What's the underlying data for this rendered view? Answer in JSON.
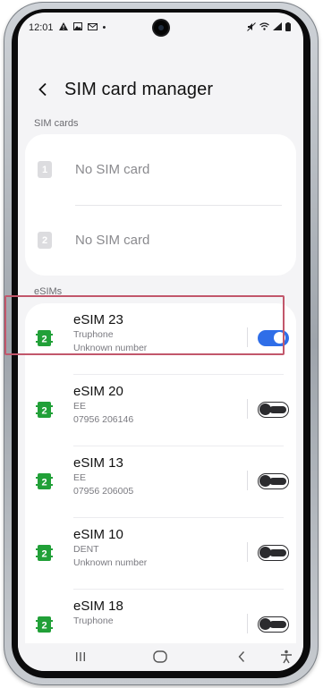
{
  "status_bar": {
    "time": "12:01",
    "left_icons": [
      "warning-icon",
      "gallery-icon",
      "mail-icon"
    ],
    "dot": "•",
    "right_icons": [
      "mute-icon",
      "wifi-icon",
      "signal-icon",
      "battery-icon"
    ]
  },
  "header": {
    "title": "SIM card manager"
  },
  "sim_cards": {
    "section_label": "SIM cards",
    "slots": [
      {
        "slot": "1",
        "label": "No SIM card"
      },
      {
        "slot": "2",
        "label": "No SIM card"
      }
    ]
  },
  "esims": {
    "section_label": "eSIMs",
    "items": [
      {
        "name": "eSIM 23",
        "carrier": "Truphone",
        "number": "Unknown number",
        "enabled": true
      },
      {
        "name": "eSIM 20",
        "carrier": "EE",
        "number": "07956 206146",
        "enabled": false
      },
      {
        "name": "eSIM 13",
        "carrier": "EE",
        "number": "07956 206005",
        "enabled": false
      },
      {
        "name": "eSIM 10",
        "carrier": "DENT",
        "number": "Unknown number",
        "enabled": false
      },
      {
        "name": "eSIM 18",
        "carrier": "Truphone",
        "number": "",
        "enabled": false
      }
    ]
  },
  "colors": {
    "accent": "#2f6ee8",
    "esim_icon": "#21a038",
    "highlight": "#c2576b"
  },
  "nav_bar": {
    "recents": "recents-icon",
    "home": "home-icon",
    "back": "back-nav-icon",
    "accessibility": "accessibility-icon"
  }
}
